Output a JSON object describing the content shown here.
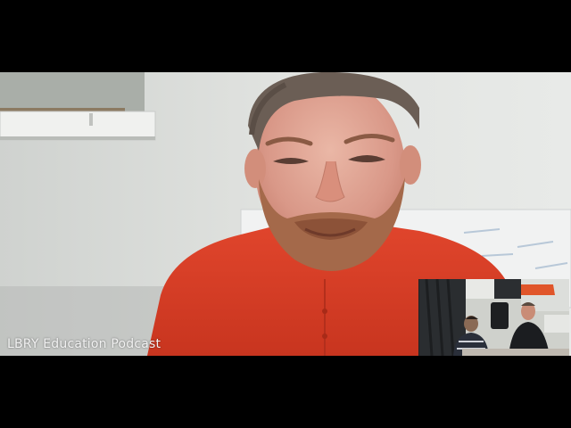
{
  "stream": {
    "caption": "LBRY Education Podcast"
  },
  "icons": {
    "main_video": "webcam-participant-video",
    "pip_video": "picture-in-picture-video"
  }
}
